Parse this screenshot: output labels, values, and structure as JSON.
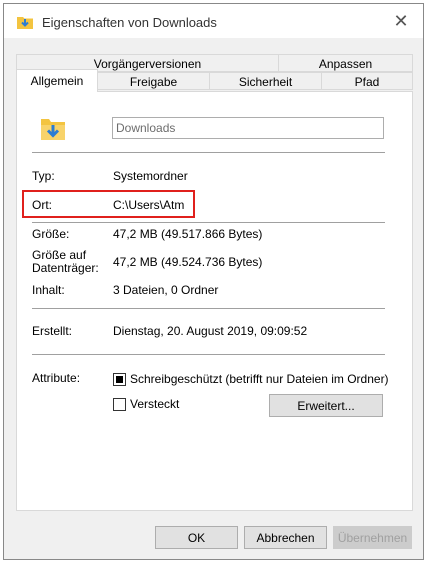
{
  "window": {
    "title": "Eigenschaften von Downloads",
    "close_glyph": "✕"
  },
  "tabs": {
    "row1": [
      "Vorgängerversionen",
      "Anpassen"
    ],
    "row2": [
      "Allgemein",
      "Freigabe",
      "Sicherheit",
      "Pfad"
    ],
    "active": "Allgemein"
  },
  "general": {
    "name_value": "Downloads",
    "type_label": "Typ:",
    "type_value": "Systemordner",
    "location_label": "Ort:",
    "location_value": "C:\\Users\\Atm",
    "size_label": "Größe:",
    "size_value": "47,2 MB (49.517.866 Bytes)",
    "size_on_disk_label_1": "Größe auf",
    "size_on_disk_label_2": "Datenträger:",
    "size_on_disk_value": "47,2 MB (49.524.736 Bytes)",
    "contents_label": "Inhalt:",
    "contents_value": "3 Dateien, 0 Ordner",
    "created_label": "Erstellt:",
    "created_value": "Dienstag, 20. August 2019, 09:09:52",
    "attributes_label": "Attribute:",
    "readonly_label": "Schreibgeschützt (betrifft nur Dateien im Ordner)",
    "readonly_state": "indeterminate",
    "hidden_label": "Versteckt",
    "hidden_state": "unchecked",
    "advanced_button": "Erweitert..."
  },
  "footer": {
    "ok": "OK",
    "cancel": "Abbrechen",
    "apply": "Übernehmen"
  },
  "colors": {
    "highlight": "#e0201c",
    "folder": "#f3c440",
    "arrow": "#2b7cd3"
  }
}
